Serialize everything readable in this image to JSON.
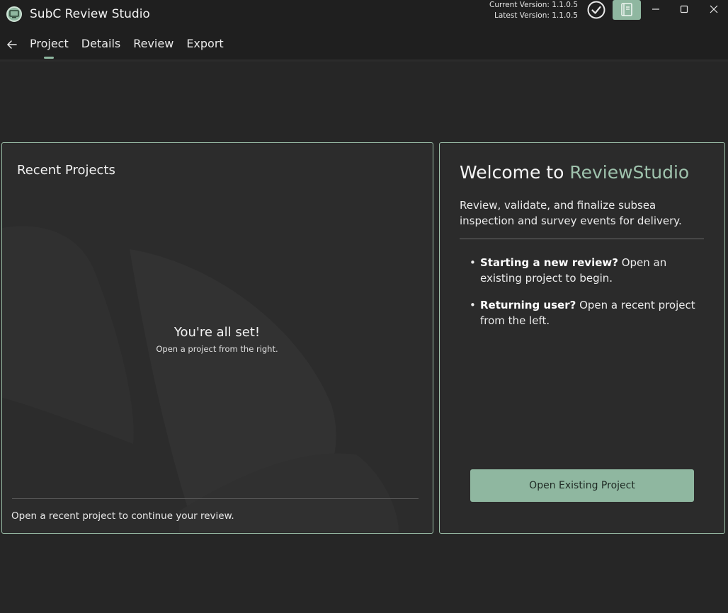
{
  "app": {
    "title": "SubC Review Studio",
    "icon": "app-logo-icon"
  },
  "versions": {
    "current": "Current Version: 1.1.0.5",
    "latest": "Latest Version: 1.1.0.5"
  },
  "titlebar": {
    "status_icon": "check-circle-icon",
    "manual_icon": "book-icon",
    "window_controls": [
      "minimize-icon",
      "maximize-icon",
      "close-icon"
    ]
  },
  "nav": {
    "back_icon": "arrow-left-icon",
    "tabs": [
      {
        "label": "Project",
        "active": true
      },
      {
        "label": "Details",
        "active": false
      },
      {
        "label": "Review",
        "active": false
      },
      {
        "label": "Export",
        "active": false
      }
    ]
  },
  "recent": {
    "title": "Recent Projects",
    "empty_title": "You're all set!",
    "empty_subtitle": "Open a project from the right.",
    "footer": "Open a recent project to continue your review."
  },
  "welcome": {
    "title_prefix": "Welcome to ",
    "title_accent": "ReviewStudio",
    "description": "Review, validate, and finalize subsea inspection and survey events for delivery.",
    "tips": [
      {
        "bold": "Starting a new review?",
        "text": " Open an existing project to begin."
      },
      {
        "bold": "Returning user?",
        "text": " Open a recent project from the left."
      }
    ],
    "open_button": "Open Existing Project"
  },
  "colors": {
    "accent": "#8fb7a0",
    "accent_text": "#9fc3ad",
    "background": "#262626",
    "panel": "#2c2c2c",
    "panel_border": "#9cbfa9"
  }
}
